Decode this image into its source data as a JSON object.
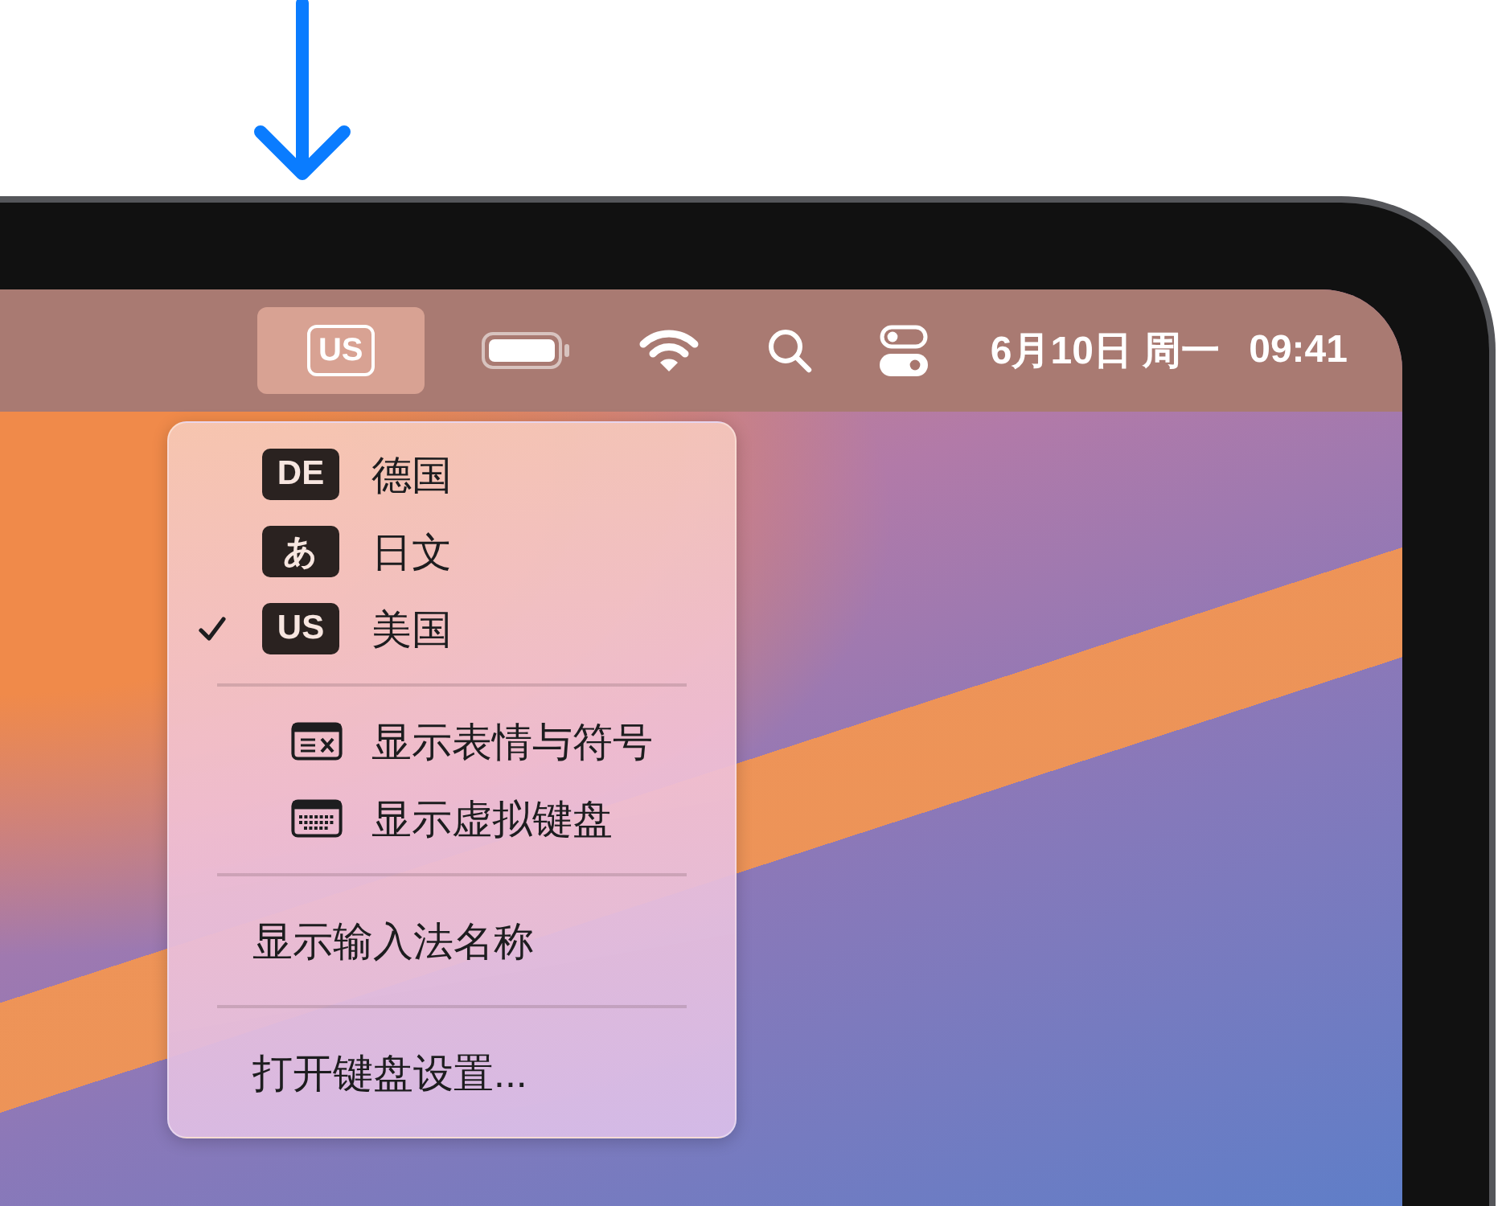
{
  "menu_bar": {
    "input_source": {
      "label": "US",
      "selected": true
    },
    "date": "6月10日 周一",
    "time": "09:41"
  },
  "menu": {
    "sections": [
      {
        "items": [
          {
            "kind": "source",
            "badge": "DE",
            "label": "德国",
            "checked": false
          },
          {
            "kind": "source",
            "badge": "あ",
            "label": "日文",
            "checked": false
          },
          {
            "kind": "source",
            "badge": "US",
            "label": "美国",
            "checked": true
          }
        ]
      },
      {
        "items": [
          {
            "kind": "emoji",
            "label": "显示表情与符号"
          },
          {
            "kind": "keyboard",
            "label": "显示虚拟键盘"
          }
        ]
      },
      {
        "items": [
          {
            "kind": "plain",
            "label": "显示输入法名称"
          }
        ]
      },
      {
        "items": [
          {
            "kind": "plain",
            "label": "打开键盘设置..."
          }
        ]
      }
    ]
  }
}
